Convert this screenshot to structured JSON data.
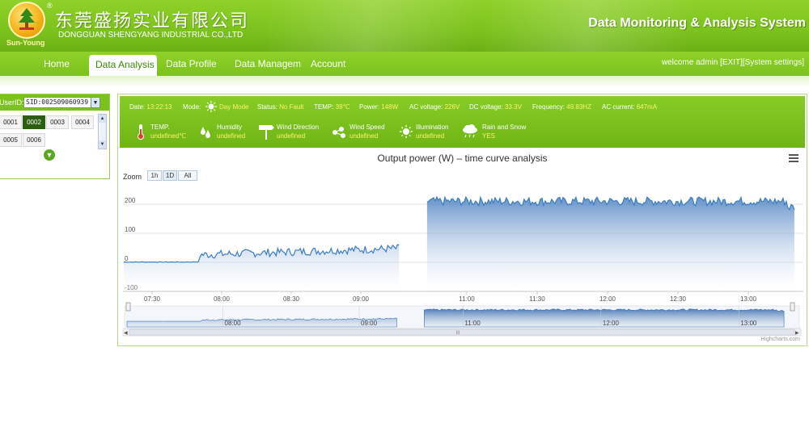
{
  "header": {
    "logo_sub": "Sun-Young",
    "logo_reg": "®",
    "company_cn": "东莞盛扬实业有限公司",
    "company_en": "DONGGUAN SHENGYANG INDUSTRIAL CO.,LTD",
    "system_title": "Data Monitoring & Analysis System"
  },
  "nav": {
    "items": [
      {
        "label": "Home"
      },
      {
        "label": "Data Analysis"
      },
      {
        "label": "Data Profile"
      },
      {
        "label": "Data Managem"
      },
      {
        "label": "Account"
      }
    ],
    "active_index": 1,
    "welcome": "welcome admin [EXIT][System settings]"
  },
  "left_panel": {
    "userid_label": "UserID:",
    "userid_value": "SID:002509060939",
    "sids": [
      "0001",
      "0002",
      "0003",
      "0004",
      "0005",
      "0006"
    ],
    "selected_sid": "0002"
  },
  "status": {
    "date_label": "Date:",
    "date_value": "13:22:13",
    "mode_label": "Mode:",
    "mode_value": "Day Mode",
    "status_label": "Status:",
    "status_value": "No Fault",
    "temp_label": "TEMP:",
    "temp_value": "39℃",
    "power_label": "Power:",
    "power_value": "148W",
    "acv_label": "AC voltage:",
    "acv_value": "226V",
    "dcv_label": "DC voltage:",
    "dcv_value": "33.3V",
    "freq_label": "Frequency:",
    "freq_value": "49.83HZ",
    "acc_label": "AC current:",
    "acc_value": "647mA",
    "sensors": [
      {
        "name": "TEMP.",
        "value": "undefined℃",
        "icon": "thermometer-icon"
      },
      {
        "name": "Humidity",
        "value": "undefined",
        "icon": "humidity-icon"
      },
      {
        "name": "Wind Direction",
        "value": "undefined",
        "icon": "wind-direction-icon"
      },
      {
        "name": "Wind Speed",
        "value": "undefined",
        "icon": "wind-speed-icon"
      },
      {
        "name": "Illumination",
        "value": "undefined",
        "icon": "sun-icon"
      },
      {
        "name": "Rain and Snow",
        "value": "YES",
        "icon": "rain-cloud-icon"
      }
    ]
  },
  "chart": {
    "title": "Output power (W) – time curve analysis",
    "zoom_label": "Zoom",
    "zoom_buttons": [
      "1h",
      "1D",
      "All"
    ],
    "selected_zoom": "1D",
    "credits": "Highcharts.com",
    "navigator_label": "III"
  },
  "chart_data": {
    "type": "area",
    "title": "Output power (W) – time curve analysis",
    "x_tick_labels": [
      "07:30",
      "08:00",
      "08:30",
      "09:00",
      "11:00",
      "11:30",
      "12:00",
      "12:30",
      "13:00"
    ],
    "y_tick_labels": [
      "-100",
      "0",
      "100",
      "200"
    ],
    "ylim": [
      -100,
      250
    ],
    "navigator_tick_labels": [
      "08:00",
      "09:00",
      "11:00",
      "12:00",
      "13:00"
    ],
    "series": [
      {
        "color": "#3b7cc4",
        "segments": [
          {
            "from": "07:30",
            "to": "07:50",
            "approx_value": 1
          },
          {
            "from": "07:50",
            "to": "09:45",
            "approx_value_range": [
              10,
              55
            ]
          },
          {
            "from": "10:15",
            "to": "13:20",
            "approx_value_range": [
              195,
              225
            ]
          }
        ]
      }
    ],
    "grid": true,
    "legend": "none"
  }
}
